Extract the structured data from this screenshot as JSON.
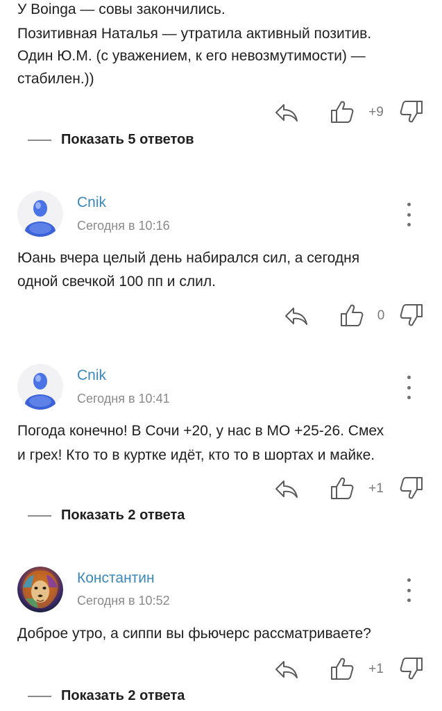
{
  "comment0": {
    "lines": [
      "У Boingа — совы закончились.",
      "Позитивная Наталья — утратила активный позитив.",
      "Один Ю.М. (с уважением, к его невозмутимости) —",
      "стабилен.))"
    ],
    "score": "+9",
    "replies": "Показать 5 ответов"
  },
  "comment1": {
    "author": "Cnik",
    "time": "Сегодня в 10:16",
    "lines": [
      " Юань вчера целый день набирался сил, а сегодня",
      "одной свечкой 100 пп и слил."
    ],
    "score": "0"
  },
  "comment2": {
    "author": "Cnik",
    "time": "Сегодня в 10:41",
    "lines": [
      "Погода конечно! В Сочи +20, у нас в МО +25-26. Смех",
      "и грех! Кто то в куртке идёт, кто то в шортах и майке."
    ],
    "score": "+1",
    "replies": "Показать 2 ответа"
  },
  "comment3": {
    "author": "Константин",
    "time": "Сегодня в 10:52",
    "lines": [
      "Доброе утро, а сиппи вы фьючерс рассматриваете?"
    ],
    "score": "+1",
    "replies": "Показать 2 ответа"
  },
  "icons": {
    "reply": "reply-arrow-icon",
    "like": "thumbs-up-icon",
    "dislike": "thumbs-down-icon",
    "menu": "more-vertical-icon",
    "avatar_default": "default-user-avatar",
    "avatar_lion": "lion-avatar"
  },
  "colors": {
    "author": "#3a87b8",
    "text": "#1f1f1f",
    "muted": "#8a8a8a"
  }
}
